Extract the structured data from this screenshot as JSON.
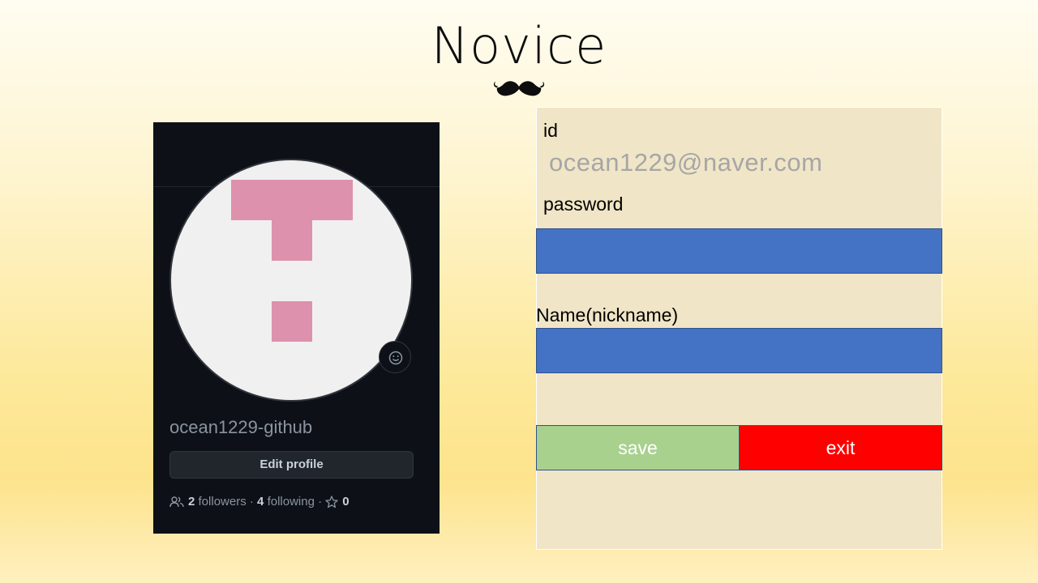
{
  "title": "Novice",
  "profile": {
    "username": "ocean1229-github",
    "edit_label": "Edit profile",
    "followers_count": "2",
    "followers_label": "followers",
    "separator": "·",
    "following_count": "4",
    "following_label": "following",
    "stars_count": "0"
  },
  "form": {
    "id_label": "id",
    "id_value": "ocean1229@naver.com",
    "password_label": "password",
    "name_label": "Name(nickname)",
    "save_label": "save",
    "exit_label": "exit"
  },
  "colors": {
    "field": "#4472c4",
    "save": "#a9d18e",
    "exit": "#ff0000",
    "panel": "#f0e5c6",
    "card": "#0d1117",
    "avatar_pattern": "#de91ac"
  }
}
